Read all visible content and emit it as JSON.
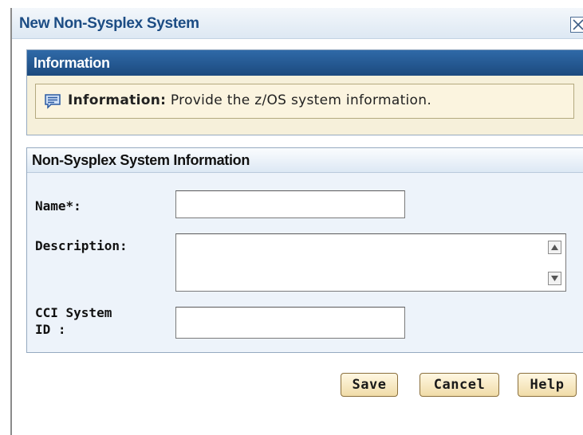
{
  "dialog": {
    "title": "New Non-Sysplex System"
  },
  "info_section": {
    "header": "Information",
    "message_label": "Information:",
    "message_text": " Provide the z/OS system information."
  },
  "form_section": {
    "header": "Non-Sysplex System Information",
    "fields": {
      "name": {
        "label": "Name*:",
        "value": "",
        "placeholder": ""
      },
      "description": {
        "label": "Description:",
        "value": ""
      },
      "cci_system_id": {
        "label_line1": "CCI System",
        "label_line2": "ID :",
        "value": "",
        "placeholder": ""
      }
    }
  },
  "buttons": {
    "save": "Save",
    "cancel": "Cancel",
    "help": "Help"
  },
  "icons": {
    "close": "close-icon",
    "info": "info-message-icon",
    "scroll_up": "scroll-up-arrow-icon",
    "scroll_down": "scroll-down-arrow-icon"
  },
  "colors": {
    "title_text": "#1c4c84",
    "info_header_bg": "#245a96",
    "info_body_bg": "#f6f0da",
    "form_body_bg": "#edf3fa",
    "button_bg": "#f6e6bd"
  }
}
